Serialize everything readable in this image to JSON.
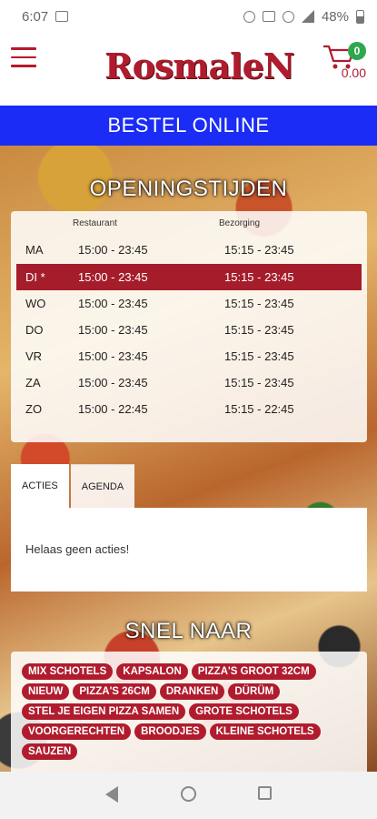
{
  "status_bar": {
    "time": "6:07",
    "battery": "48%"
  },
  "header": {
    "logo_text": "RosmaleN",
    "cart_count": "0",
    "cart_total": "0.00"
  },
  "bestel_label": "BESTEL ONLINE",
  "opening": {
    "title": "OPENINGSTIJDEN",
    "col_restaurant": "Restaurant",
    "col_bezorging": "Bezorging",
    "rows": [
      {
        "day": "MA",
        "restaurant": "15:00 - 23:45",
        "bezorging": "15:15 - 23:45"
      },
      {
        "day": "DI *",
        "restaurant": "15:00 - 23:45",
        "bezorging": "15:15 - 23:45"
      },
      {
        "day": "WO",
        "restaurant": "15:00 - 23:45",
        "bezorging": "15:15 - 23:45"
      },
      {
        "day": "DO",
        "restaurant": "15:00 - 23:45",
        "bezorging": "15:15 - 23:45"
      },
      {
        "day": "VR",
        "restaurant": "15:00 - 23:45",
        "bezorging": "15:15 - 23:45"
      },
      {
        "day": "ZA",
        "restaurant": "15:00 - 23:45",
        "bezorging": "15:15 - 23:45"
      },
      {
        "day": "ZO",
        "restaurant": "15:00 - 22:45",
        "bezorging": "15:15 - 22:45"
      }
    ]
  },
  "tabs": {
    "acties": "ACTIES",
    "agenda": "AGENDA",
    "empty_text": "Helaas geen acties!"
  },
  "snel_naar": {
    "title": "SNEL NAAR",
    "chips": [
      "MIX SCHOTELS",
      "KAPSALON",
      "PIZZA'S GROOT 32CM",
      "NIEUW",
      "PIZZA'S 26CM",
      "DRANKEN",
      "DÜRÜM",
      "STEL JE EIGEN PIZZA SAMEN",
      "GROTE SCHOTELS",
      "VOORGERECHTEN",
      "BROODJES",
      "KLEINE SCHOTELS",
      "SAUZEN"
    ]
  },
  "colors": {
    "brand_red": "#b01c2e",
    "bestel_blue": "#1a2cf5",
    "cart_badge_green": "#2ea84f"
  }
}
